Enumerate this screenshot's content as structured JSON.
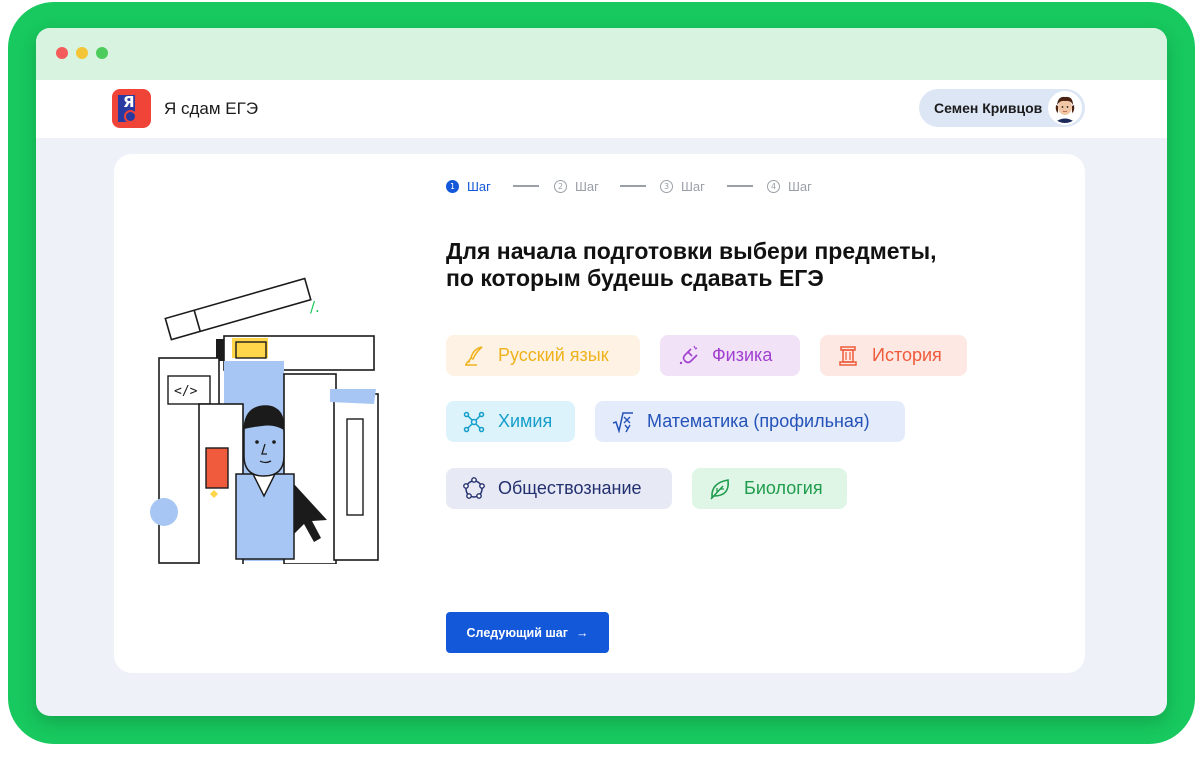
{
  "app": {
    "title": "Я сдам ЕГЭ",
    "logo_letter": "Я"
  },
  "user": {
    "name": "Семен Кривцов"
  },
  "stepper": {
    "steps": [
      {
        "number": "1",
        "label": "Шаг",
        "active": true
      },
      {
        "number": "2",
        "label": "Шаг",
        "active": false
      },
      {
        "number": "3",
        "label": "Шаг",
        "active": false
      },
      {
        "number": "4",
        "label": "Шаг",
        "active": false
      }
    ]
  },
  "heading": {
    "line1": "Для начала подготовки выбери предметы,",
    "line2": "по которым будешь сдавать ЕГЭ"
  },
  "subjects": [
    {
      "label": "Русский язык",
      "icon": "quill-pen-icon",
      "bg": "#fdf2e3",
      "color": "#f0b21c"
    },
    {
      "label": "Физика",
      "icon": "magnet-icon",
      "bg": "#f1e2f7",
      "color": "#a13fd0"
    },
    {
      "label": "История",
      "icon": "column-icon",
      "bg": "#fde8e4",
      "color": "#ef5a3a"
    },
    {
      "label": "Химия",
      "icon": "molecule-icon",
      "bg": "#dcf3fb",
      "color": "#159ecb"
    },
    {
      "label": "Математика (профильная)",
      "icon": "sqrt-icon",
      "bg": "#e4ecfb",
      "color": "#2452b8"
    },
    {
      "label": "Обществознание",
      "icon": "people-circle-icon",
      "bg": "#e7e9f5",
      "color": "#23306f"
    },
    {
      "label": "Биология",
      "icon": "leaf-icon",
      "bg": "#dff6e7",
      "color": "#1f9c4c"
    }
  ],
  "next_button": {
    "label": "Следующий шаг",
    "arrow": "→"
  },
  "colors": {
    "frame": "#17c95e",
    "accent": "#1358d8"
  }
}
